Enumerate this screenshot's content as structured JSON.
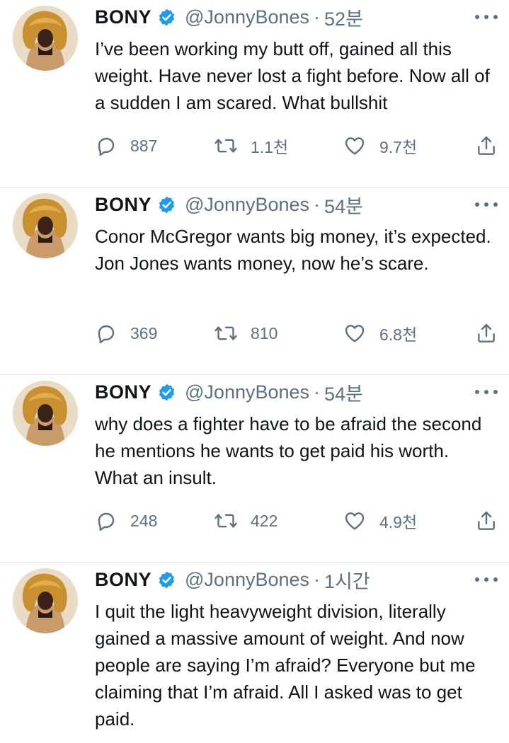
{
  "colors": {
    "verified": "#1d9bf0",
    "secondary_text": "#5b7083",
    "primary_text": "#0f1419",
    "divider": "#e1e6ea"
  },
  "icons": {
    "reply": "reply-icon",
    "retweet": "retweet-icon",
    "like": "heart-icon",
    "share": "share-icon",
    "more": "more-icon",
    "verified": "verified-badge-icon"
  },
  "tweets": [
    {
      "name": "BONY",
      "handle": "@JonnyBones",
      "separator": "·",
      "time": "52분",
      "text": "I’ve been working my butt off, gained all this weight. Have never lost a fight before. Now all of a sudden I am scared. What bullshit",
      "replies": "887",
      "retweets": "1.1천",
      "likes": "9.7천"
    },
    {
      "name": "BONY",
      "handle": "@JonnyBones",
      "separator": "·",
      "time": "54분",
      "text": "Conor McGregor wants big money, it’s expected. Jon Jones wants money, now he’s scare.",
      "replies": "369",
      "retweets": "810",
      "likes": "6.8천"
    },
    {
      "name": "BONY",
      "handle": "@JonnyBones",
      "separator": "·",
      "time": "54분",
      "text": "why does a fighter have to be afraid the second he mentions he wants to get paid his worth. What an insult.",
      "replies": "248",
      "retweets": "422",
      "likes": "4.9천"
    },
    {
      "name": "BONY",
      "handle": "@JonnyBones",
      "separator": "·",
      "time": "1시간",
      "text": "I quit the light heavyweight division, literally gained a massive amount of weight. And now people are saying I’m afraid? Everyone but me claiming that I’m afraid. All I asked was to get paid."
    }
  ]
}
